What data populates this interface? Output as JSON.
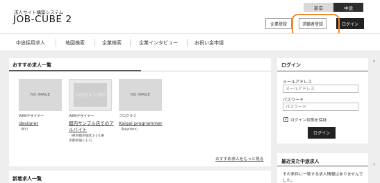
{
  "header": {
    "subtitle": "求人サイト構築システム",
    "logo": "JOB-CUBE 2",
    "toggle": {
      "new_grad": "新卒",
      "mid_career": "中途"
    },
    "buttons": {
      "corporate": "企業登録",
      "job_seeker": "求職者登録",
      "login": "ログイン"
    },
    "highlight_color": "#ef8a2c"
  },
  "nav": {
    "items": [
      "中途採用求人",
      "地図検索",
      "企業検索",
      "企業インタビュー",
      "お祝い金申請"
    ]
  },
  "recommended": {
    "title": "おすすめ求人一覧",
    "jobs": [
      {
        "thumb": "NO IMAGE",
        "category": "WEBデザイナー",
        "name": "designer",
        "location": [
          "（NY）"
        ]
      },
      {
        "thumb": "1200 x 1200",
        "category": "WEBデザイナー",
        "name": "都内サンプル店でのアルバイト",
        "name_lines": [
          "都内サンプル店でのア",
          "ルバイト"
        ],
        "location": [
          "（東京都新宿区1-1-1東",
          "京都新宿1-1-1）"
        ]
      },
      {
        "thumb": "NO IMAGE",
        "category": "プログラマ",
        "name": "Kaigai programmer",
        "location": [
          "（NewYork）"
        ]
      }
    ],
    "more_link": "おすすめ求人をもっと見る"
  },
  "new_jobs": {
    "title": "新着求人一覧"
  },
  "login": {
    "title": "ログイン",
    "email_label": "メールアドレス",
    "email_placeholder": "メールアドレス",
    "password_label": "パスワード",
    "password_placeholder": "パスワード",
    "keep_label": "ログイン状態を保持",
    "keep_checked": true,
    "submit": "ログイン"
  },
  "recent": {
    "title": "最近見た中途求人",
    "message": "その条件に一致する求人情報はありませんでした。"
  },
  "icons": {
    "check": "check-icon",
    "scroll_up": "scroll-up-icon",
    "scroll_down": "scroll-down-icon"
  }
}
